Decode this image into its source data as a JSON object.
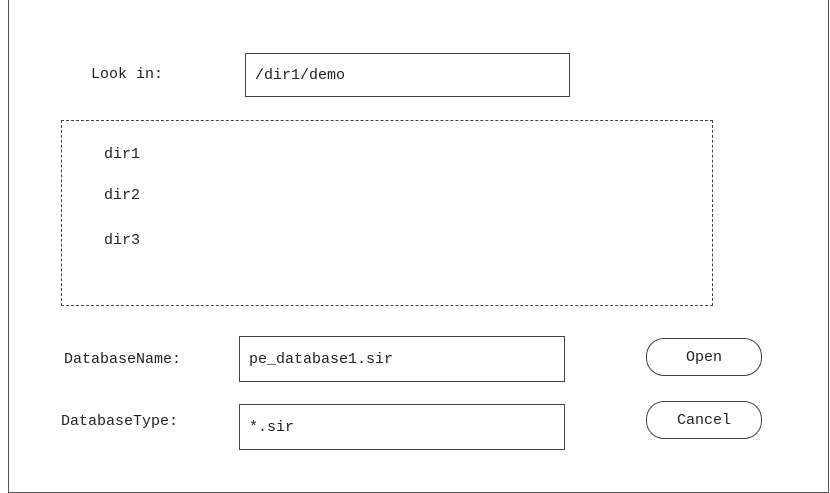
{
  "look_in": {
    "label": "Look in:",
    "value": "/dir1/demo"
  },
  "directories": [
    {
      "name": "dir1"
    },
    {
      "name": "dir2"
    },
    {
      "name": "dir3"
    }
  ],
  "database_name": {
    "label": "DatabaseName:",
    "value": "pe_database1.sir"
  },
  "database_type": {
    "label": "DatabaseType:",
    "value": "*.sir"
  },
  "buttons": {
    "open": "Open",
    "cancel": "Cancel"
  }
}
